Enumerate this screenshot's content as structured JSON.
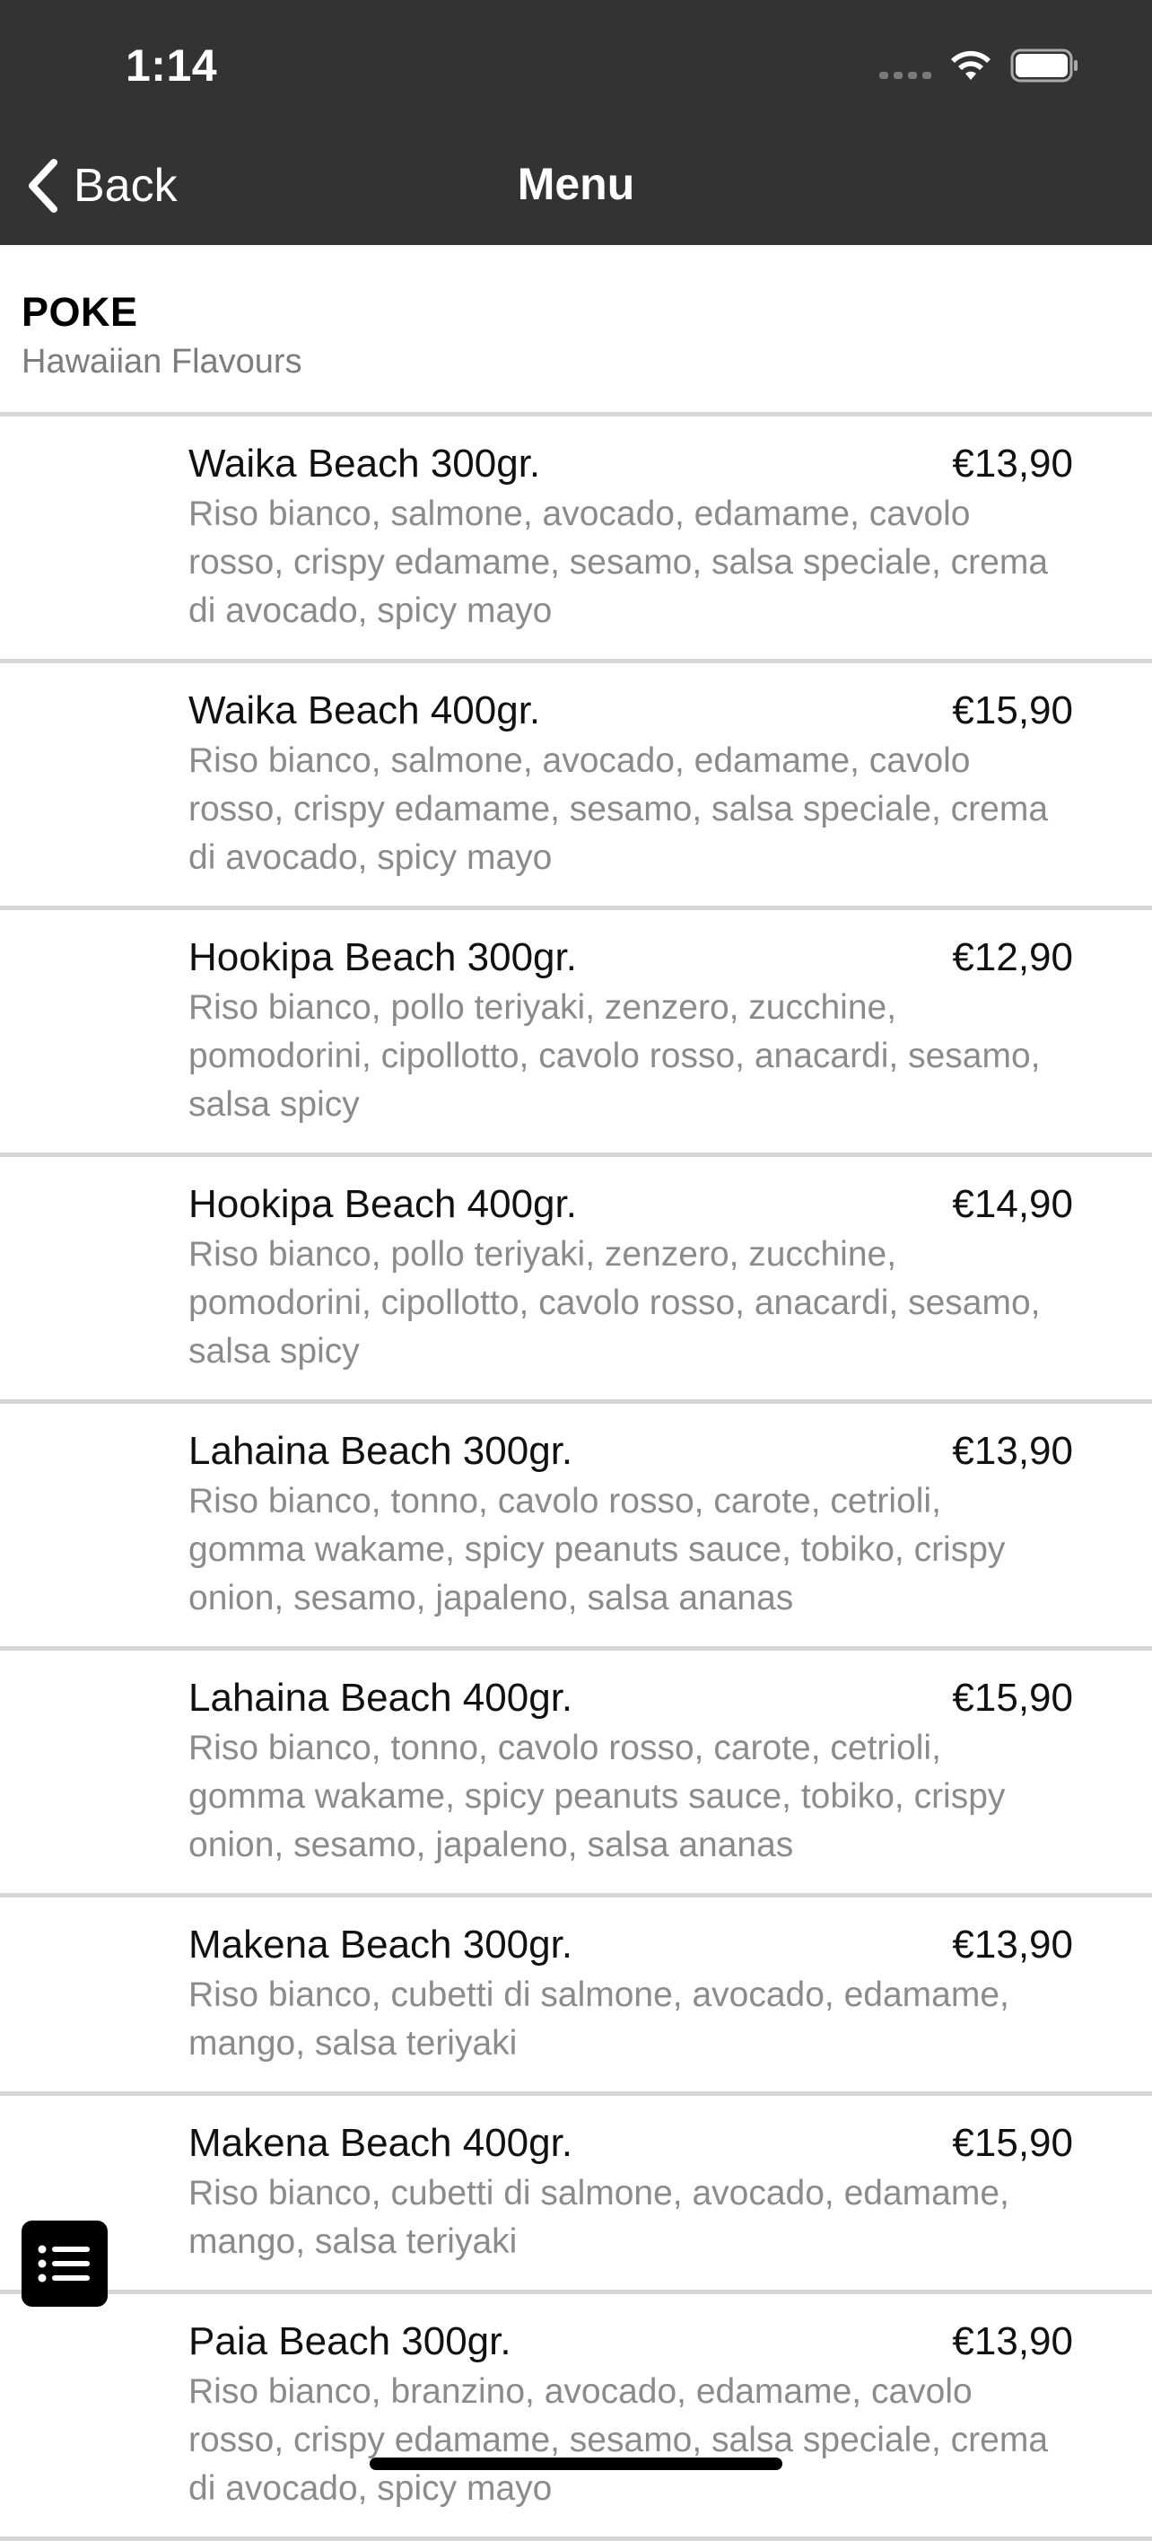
{
  "status_bar": {
    "time": "1:14"
  },
  "nav": {
    "back_label": "Back",
    "title": "Menu"
  },
  "section": {
    "title": "POKE",
    "subtitle": "Hawaiian Flavours"
  },
  "items": [
    {
      "name": "Waika Beach 300gr.",
      "price": "€13,90",
      "description": "Riso bianco, salmone, avocado, edamame, cavolo rosso, crispy edamame, sesamo, salsa speciale, crema di avocado, spicy mayo"
    },
    {
      "name": "Waika Beach 400gr.",
      "price": "€15,90",
      "description": "Riso bianco, salmone, avocado, edamame, cavolo rosso, crispy edamame, sesamo, salsa speciale, crema di avocado, spicy mayo"
    },
    {
      "name": "Hookipa Beach 300gr.",
      "price": "€12,90",
      "description": "Riso bianco, pollo teriyaki, zenzero, zucchine, pomodorini, cipollotto, cavolo rosso, anacardi, sesamo, salsa spicy"
    },
    {
      "name": "Hookipa Beach 400gr.",
      "price": "€14,90",
      "description": "Riso bianco, pollo teriyaki, zenzero, zucchine, pomodorini, cipollotto, cavolo rosso, anacardi, sesamo, salsa spicy"
    },
    {
      "name": "Lahaina Beach 300gr.",
      "price": "€13,90",
      "description": "Riso bianco, tonno, cavolo rosso, carote, cetrioli, gomma wakame, spicy peanuts sauce, tobiko, crispy onion, sesamo, japaleno, salsa ananas"
    },
    {
      "name": "Lahaina Beach 400gr.",
      "price": "€15,90",
      "description": "Riso bianco, tonno, cavolo rosso, carote, cetrioli, gomma wakame, spicy peanuts sauce, tobiko, crispy onion, sesamo, japaleno, salsa ananas"
    },
    {
      "name": "Makena Beach 300gr.",
      "price": "€13,90",
      "description": "Riso bianco, cubetti di salmone, avocado, edamame, mango, salsa teriyaki"
    },
    {
      "name": "Makena Beach 400gr.",
      "price": "€15,90",
      "description": "Riso bianco, cubetti di salmone, avocado, edamame, mango, salsa teriyaki"
    },
    {
      "name": "Paia Beach 300gr.",
      "price": "€13,90",
      "description": "Riso bianco, branzino, avocado, edamame, cavolo rosso, crispy edamame, sesamo, salsa speciale, crema di avocado, spicy mayo"
    }
  ],
  "icons": {
    "back": "chevron-left-icon",
    "wifi": "wifi-icon",
    "battery": "battery-icon",
    "signal": "cellular-signal-icon",
    "menu_fab": "list-icon"
  },
  "colors": {
    "header_bg": "#333333",
    "divider": "#d6d6d6",
    "secondary_text": "#8b8b8b"
  }
}
